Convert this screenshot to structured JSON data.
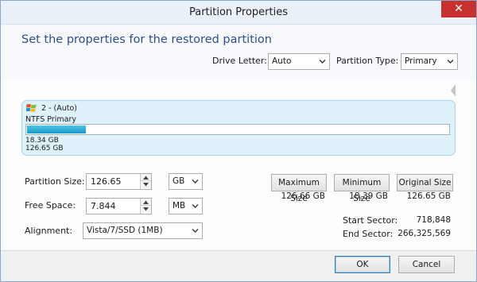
{
  "window": {
    "title": "Partition Properties",
    "close_glyph": "✕"
  },
  "header": {
    "heading": "Set the properties for the restored partition",
    "drive_letter_label": "Drive Letter:",
    "drive_letter_value": "Auto",
    "partition_type_label": "Partition Type:",
    "partition_type_value": "Primary"
  },
  "partition": {
    "name": "2 -  (Auto)",
    "type": "NTFS Primary",
    "used_size": "18.34 GB",
    "total_size": "126.65 GB",
    "used_fraction": 0.14
  },
  "settings": {
    "partition_size_label": "Partition Size:",
    "partition_size_value": "126.65",
    "partition_size_unit": "GB",
    "free_space_label": "Free Space:",
    "free_space_value": "7.844",
    "free_space_unit": "MB",
    "alignment_label": "Alignment:",
    "alignment_value": "Vista/7/SSD (1MB)"
  },
  "size_buttons": {
    "maximum_label": "Maximum Size",
    "maximum_value": "126.66 GB",
    "minimum_label": "Minimum Size",
    "minimum_value": "18.39 GB",
    "original_label": "Original Size",
    "original_value": "126.65 GB"
  },
  "sectors": {
    "start_label": "Start Sector:",
    "start_value": "718,848",
    "end_label": "End Sector:",
    "end_value": "266,325,569"
  },
  "footer": {
    "ok_label": "OK",
    "cancel_label": "Cancel"
  },
  "colors": {
    "accent_heading": "#2a4f8a",
    "close_red": "#c7302d",
    "bar_fill": "#1b99c7",
    "card_bg": "#dff1fb"
  }
}
